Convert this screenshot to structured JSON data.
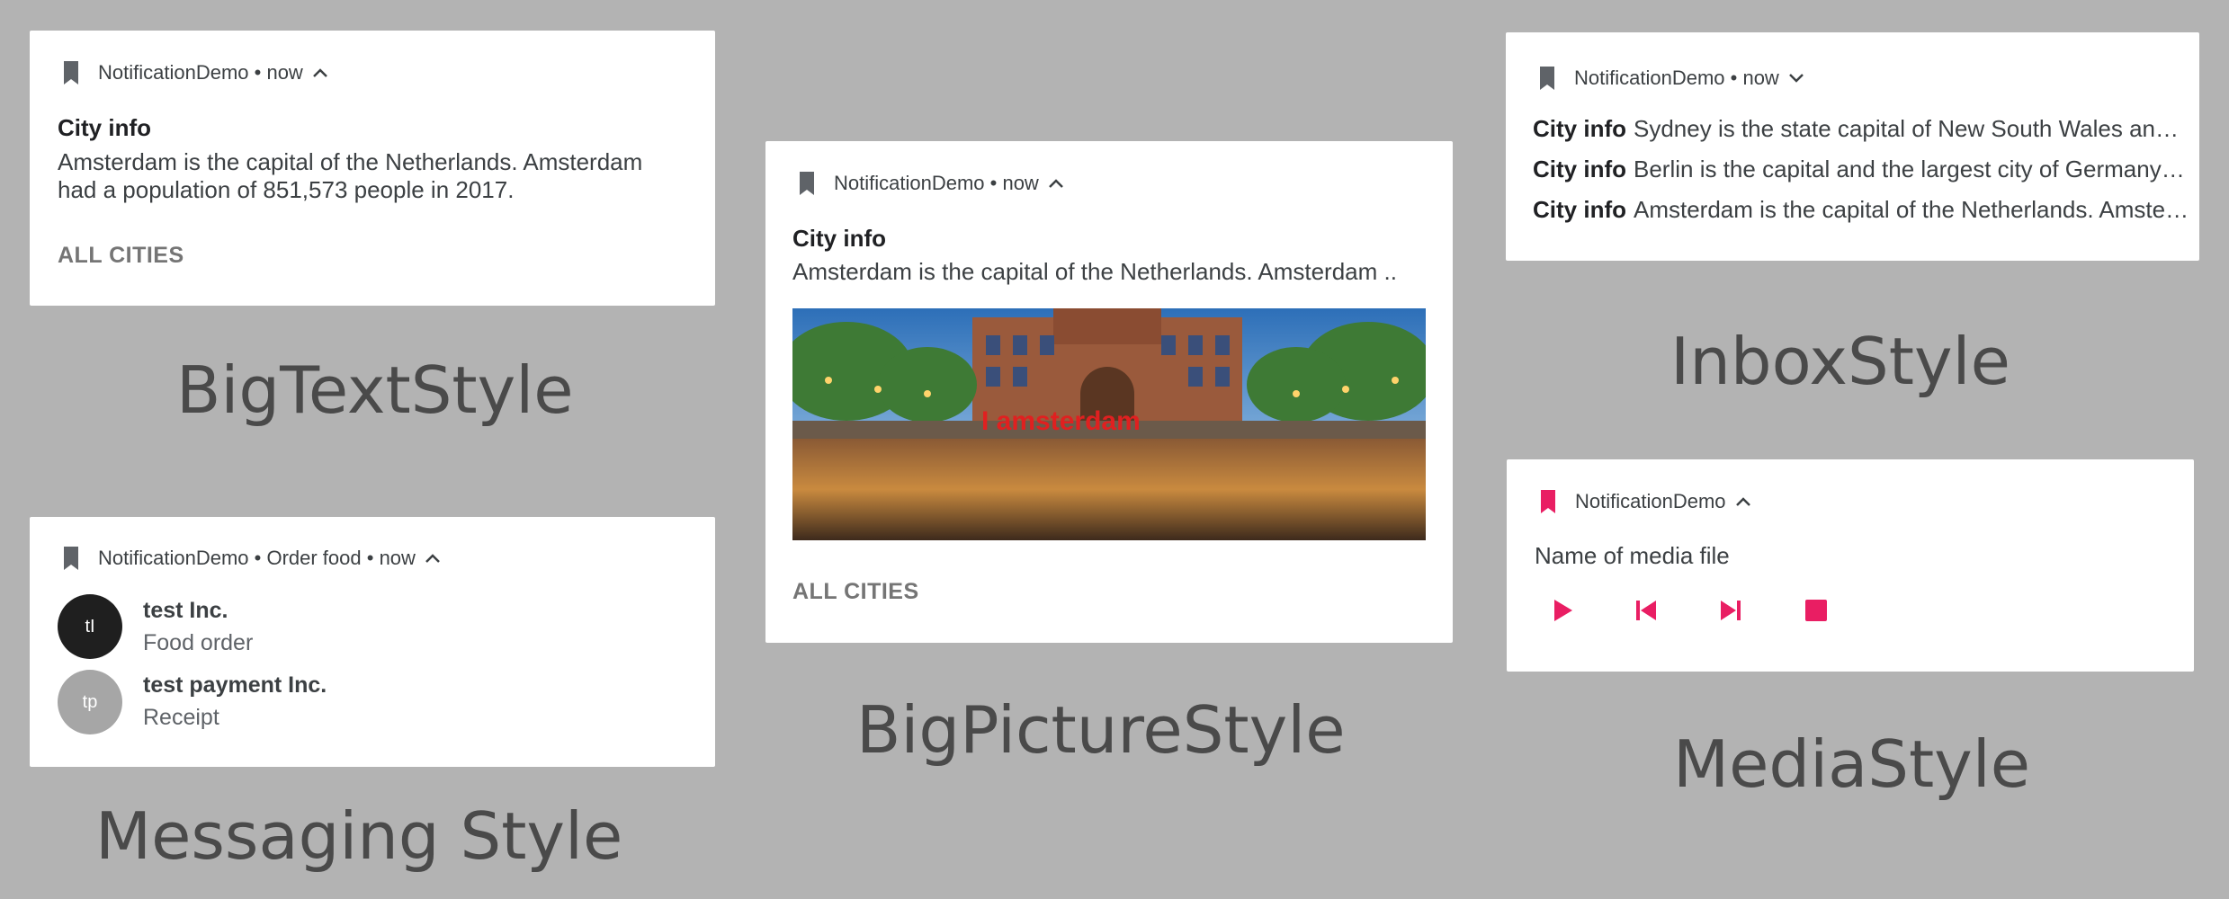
{
  "big_text": {
    "app_name": "NotificationDemo",
    "time": "now",
    "title": "City info",
    "text": "Amsterdam is the capital of the Netherlands. Amsterdam had a population of 851,573 people in 2017.",
    "action": "ALL CITIES",
    "caption": "BigTextStyle"
  },
  "big_picture": {
    "app_name": "NotificationDemo",
    "time": "now",
    "title": "City info",
    "text": "Amsterdam is the capital of the Netherlands. Amsterdam ..",
    "image_sign": "I amsterdam",
    "action": "ALL CITIES",
    "caption": "BigPictureStyle"
  },
  "inbox": {
    "app_name": "NotificationDemo",
    "time": "now",
    "lines": [
      {
        "title": "City info",
        "text": "Sydney is the state capital of New South Wales and the most populous city in Australia."
      },
      {
        "title": "City info",
        "text": "Berlin is the capital and the largest city of Germany by both area and population."
      },
      {
        "title": "City info",
        "text": "Amsterdam is the capital of the Netherlands. Amsterdam had a population of 851,573 people in 2017."
      }
    ],
    "caption": "InboxStyle"
  },
  "messaging": {
    "app_name": "NotificationDemo",
    "conversation": "Order food",
    "time": "now",
    "messages": [
      {
        "initials": "tI",
        "sender": "test Inc.",
        "text": "Food order",
        "avatar_color": "#1f1f1f"
      },
      {
        "initials": "tp",
        "sender": "test payment Inc.",
        "text": "Receipt",
        "avatar_color": "#a6a6a6"
      }
    ],
    "caption": "Messaging Style"
  },
  "media": {
    "app_name": "NotificationDemo",
    "title": "Name of media file",
    "accent": "#e91e63",
    "controls": [
      "play-icon",
      "skip-previous-icon",
      "skip-next-icon",
      "stop-icon"
    ],
    "caption": "MediaStyle"
  }
}
